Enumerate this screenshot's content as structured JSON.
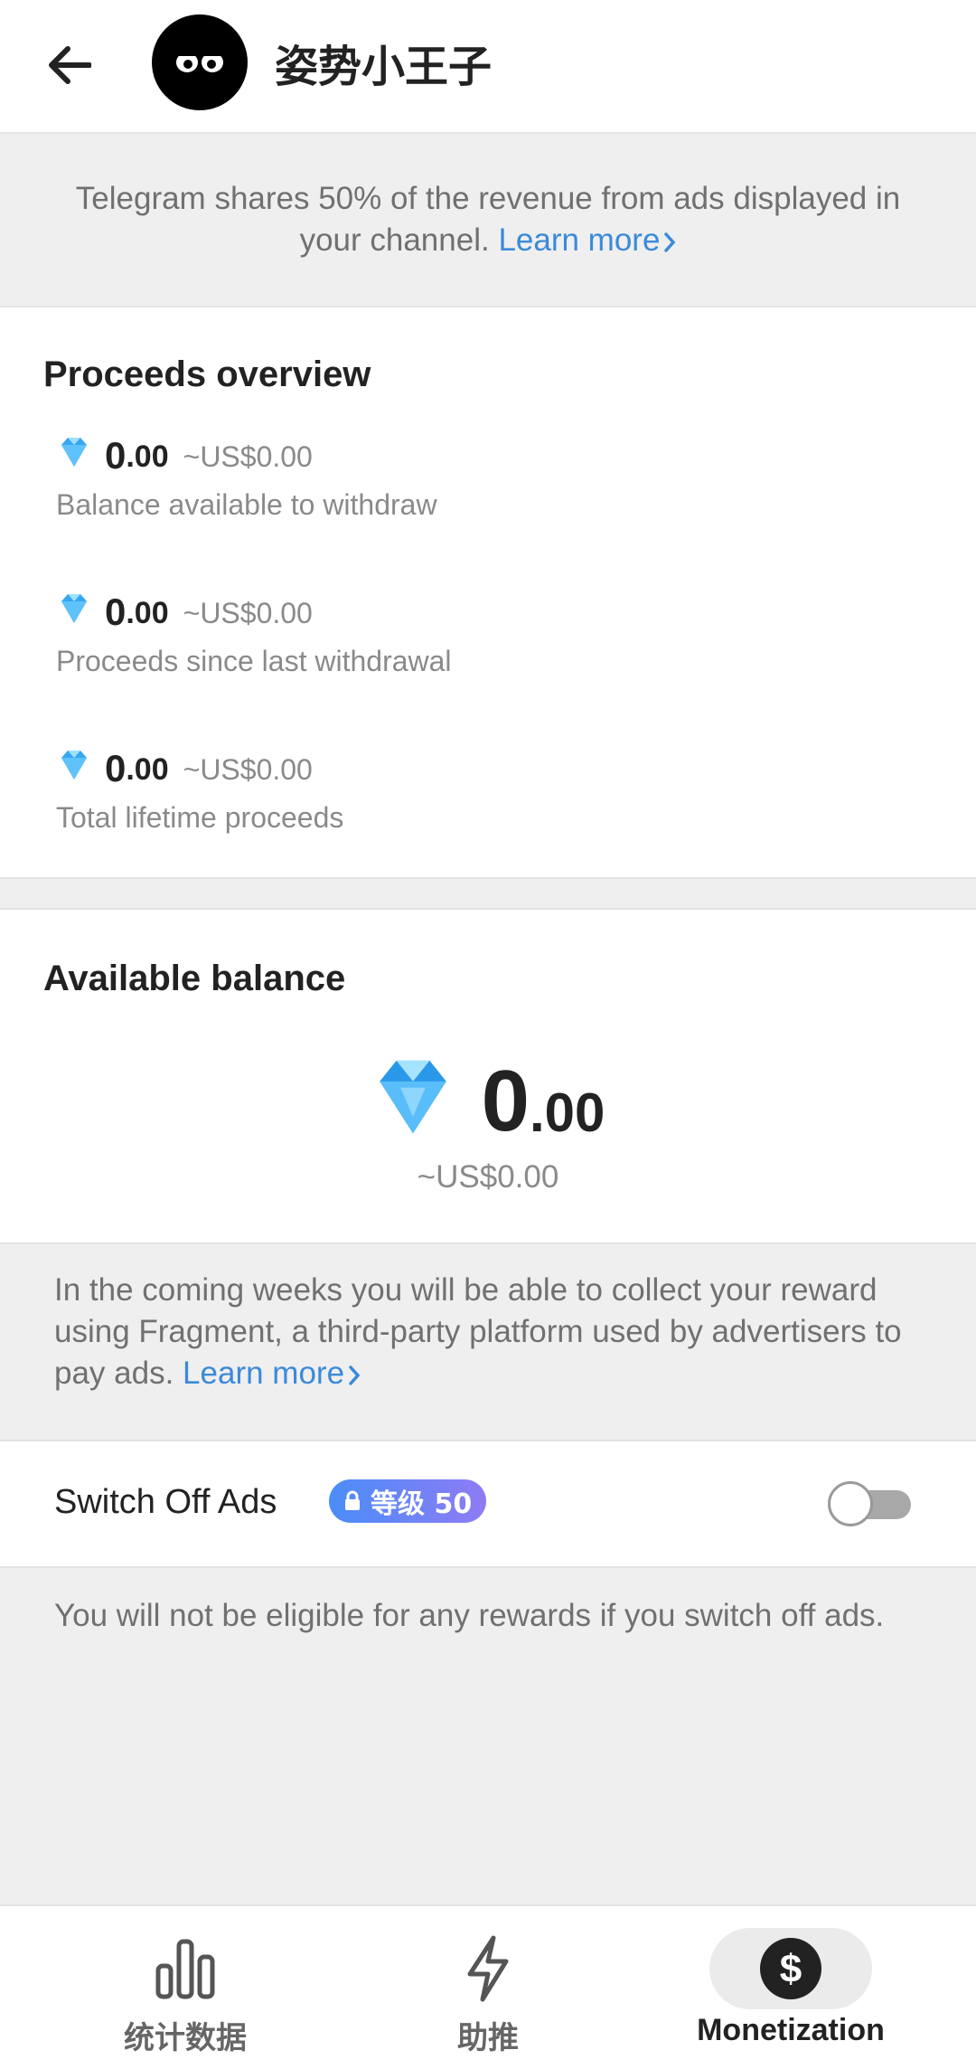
{
  "header": {
    "title": "姿势小王子",
    "back_icon": "arrow-left-icon",
    "avatar_icon": "eyes-avatar-icon"
  },
  "info_banner": {
    "text": "Telegram shares 50% of the revenue from ads displayed in your channel.",
    "link": "Learn more"
  },
  "proceeds": {
    "title": "Proceeds overview",
    "items": [
      {
        "ton_int": "0",
        "ton_dec": ".00",
        "usd": "~US$0.00",
        "label": "Balance available to withdraw"
      },
      {
        "ton_int": "0",
        "ton_dec": ".00",
        "usd": "~US$0.00",
        "label": "Proceeds since last withdrawal"
      },
      {
        "ton_int": "0",
        "ton_dec": ".00",
        "usd": "~US$0.00",
        "label": "Total lifetime proceeds"
      }
    ]
  },
  "balance": {
    "title": "Available balance",
    "ton_int": "0",
    "ton_dec": ".00",
    "usd": "~US$0.00"
  },
  "fragment_note": {
    "text": "In the coming weeks you will be able to collect your reward using Fragment, a third-party platform used by advertisers to pay ads.",
    "link": "Learn more"
  },
  "switch_ads": {
    "label": "Switch Off Ads",
    "badge": "等级 50",
    "enabled": false
  },
  "ads_note": "You will not be eligible for any rewards if you switch off ads.",
  "bottom_nav": {
    "tabs": [
      {
        "label": "统计数据",
        "icon": "bar-chart-icon",
        "active": false
      },
      {
        "label": "助推",
        "icon": "lightning-icon",
        "active": false
      },
      {
        "label": "Monetization",
        "icon": "dollar-icon",
        "active": true
      }
    ]
  },
  "colors": {
    "accent_link": "#3a8ad9",
    "background": "#efefef",
    "badge_gradient_start": "#4b8df8",
    "badge_gradient_end": "#8e7bf5"
  }
}
